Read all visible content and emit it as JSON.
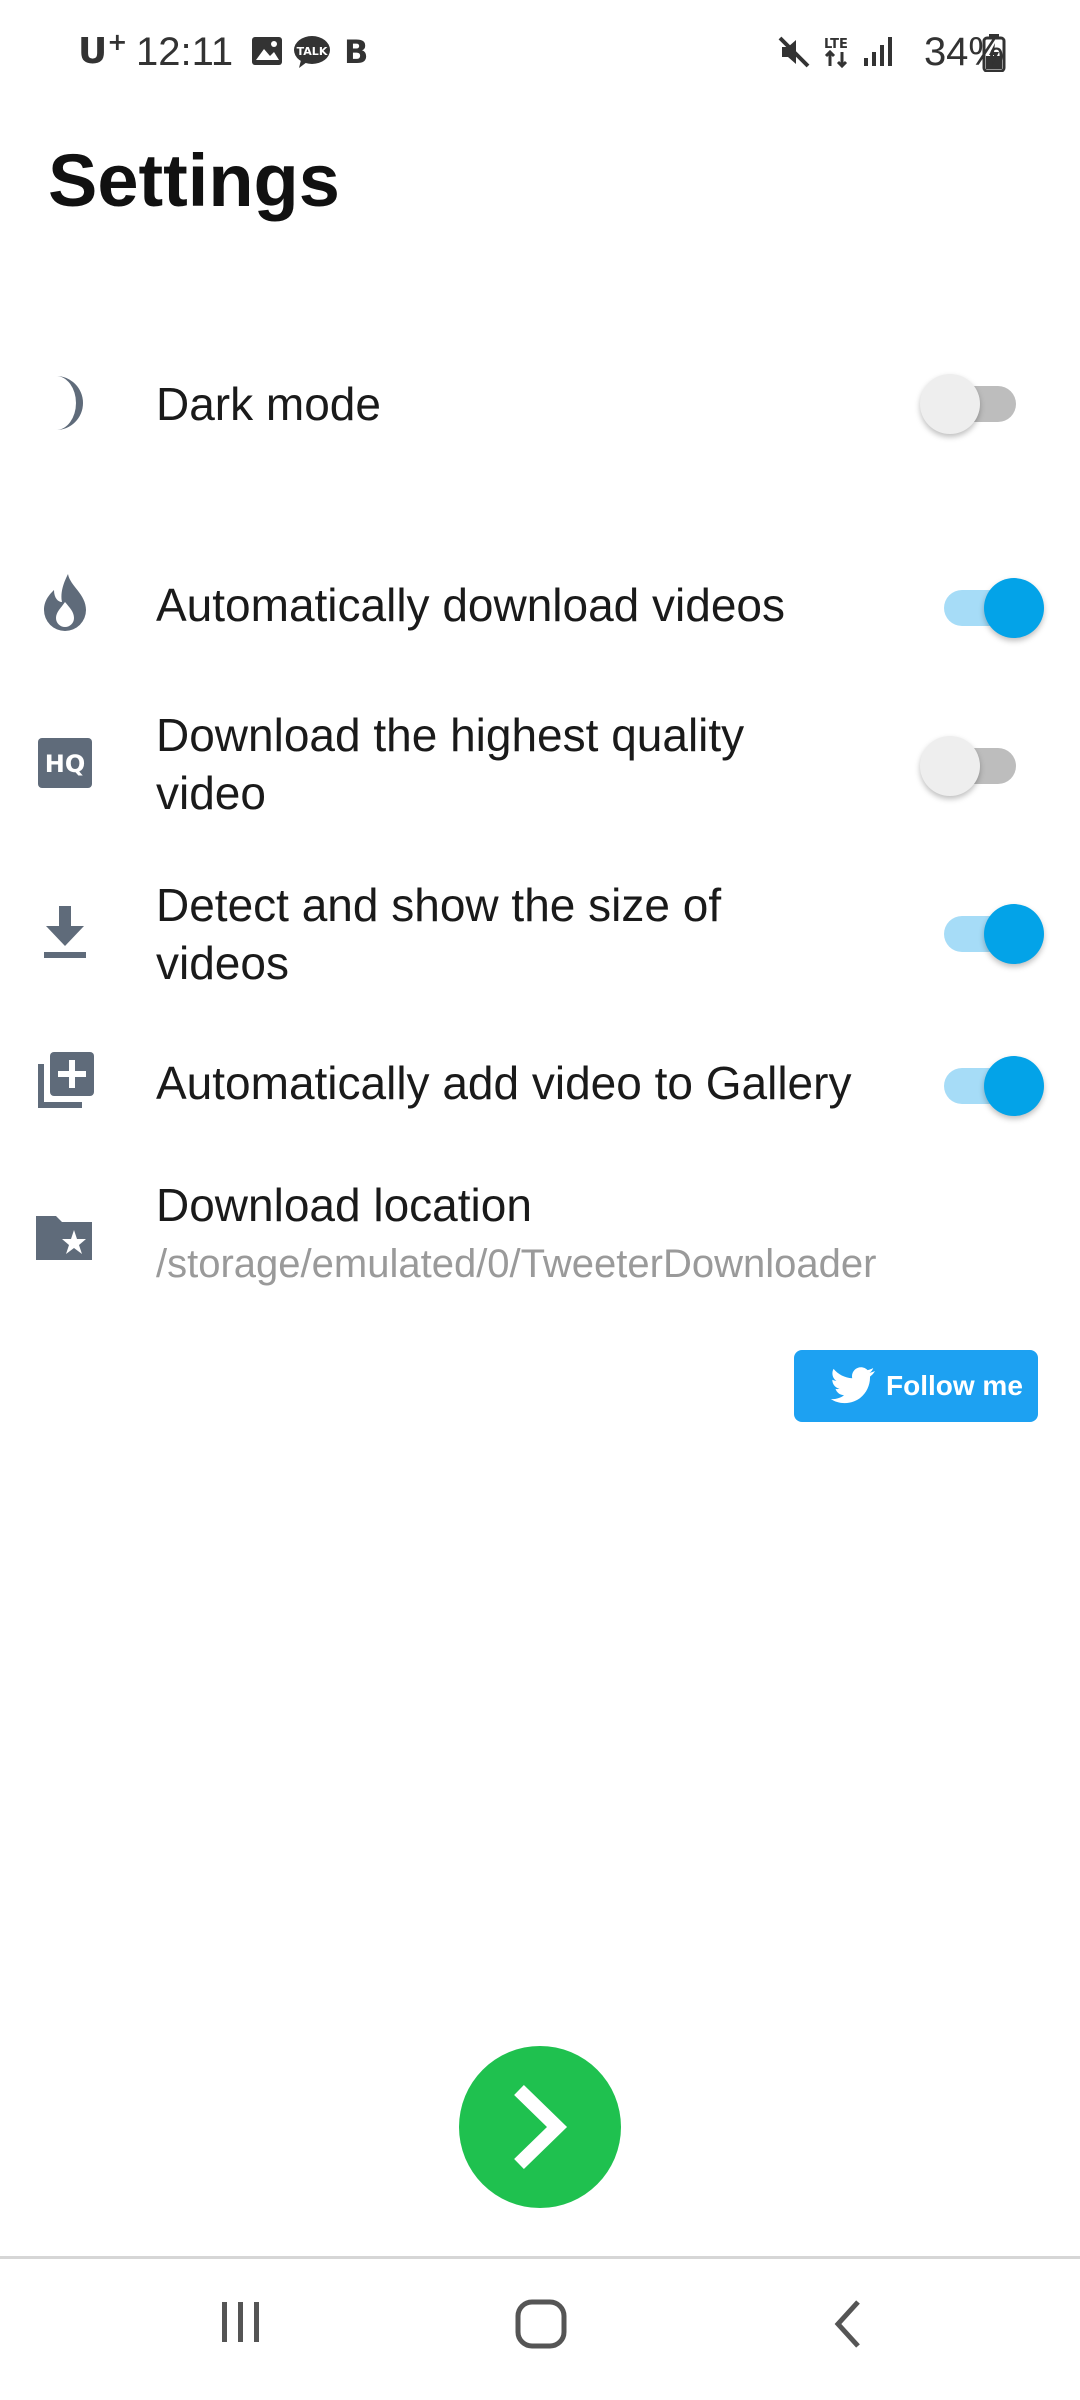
{
  "status_bar": {
    "carrier": "U",
    "carrier_sup": "+",
    "time": "12:11",
    "battery": "34%",
    "network": "LTE",
    "icons": [
      "image-icon",
      "talk-icon",
      "b-icon",
      "mute-icon",
      "lte-icon",
      "signal-icon",
      "battery-charging-icon"
    ]
  },
  "page": {
    "title": "Settings"
  },
  "settings": {
    "dark_mode": {
      "label": "Dark mode",
      "icon": "moon-icon",
      "enabled": false
    },
    "auto_download": {
      "label": "Automatically download videos",
      "icon": "flame-icon",
      "enabled": true
    },
    "highest_quality": {
      "label": "Download the highest quality video",
      "icon": "hq-icon",
      "enabled": false
    },
    "detect_size": {
      "label": "Detect and show the size of videos",
      "icon": "download-icon",
      "enabled": true
    },
    "add_to_gallery": {
      "label": "Automatically add video to Gallery",
      "icon": "add-to-library-icon",
      "enabled": true
    },
    "download_location": {
      "label": "Download location",
      "value": "/storage/emulated/0/TweeterDownloader",
      "icon": "folder-star-icon"
    }
  },
  "follow_button": {
    "label": "Follow me",
    "icon": "twitter-bird-icon",
    "color": "#1da1f2"
  },
  "next_button": {
    "icon": "chevron-right-icon",
    "color": "#1fc14f"
  },
  "nav_bar": {
    "items": [
      "recent-apps-icon",
      "home-icon",
      "back-icon"
    ]
  },
  "colors": {
    "toggle_on": "#03a3e8",
    "toggle_on_track": "#a6dcf7",
    "toggle_off": "#eeeeee",
    "toggle_off_track": "#bdbdbd",
    "icon_gray": "#5f6b7a"
  }
}
